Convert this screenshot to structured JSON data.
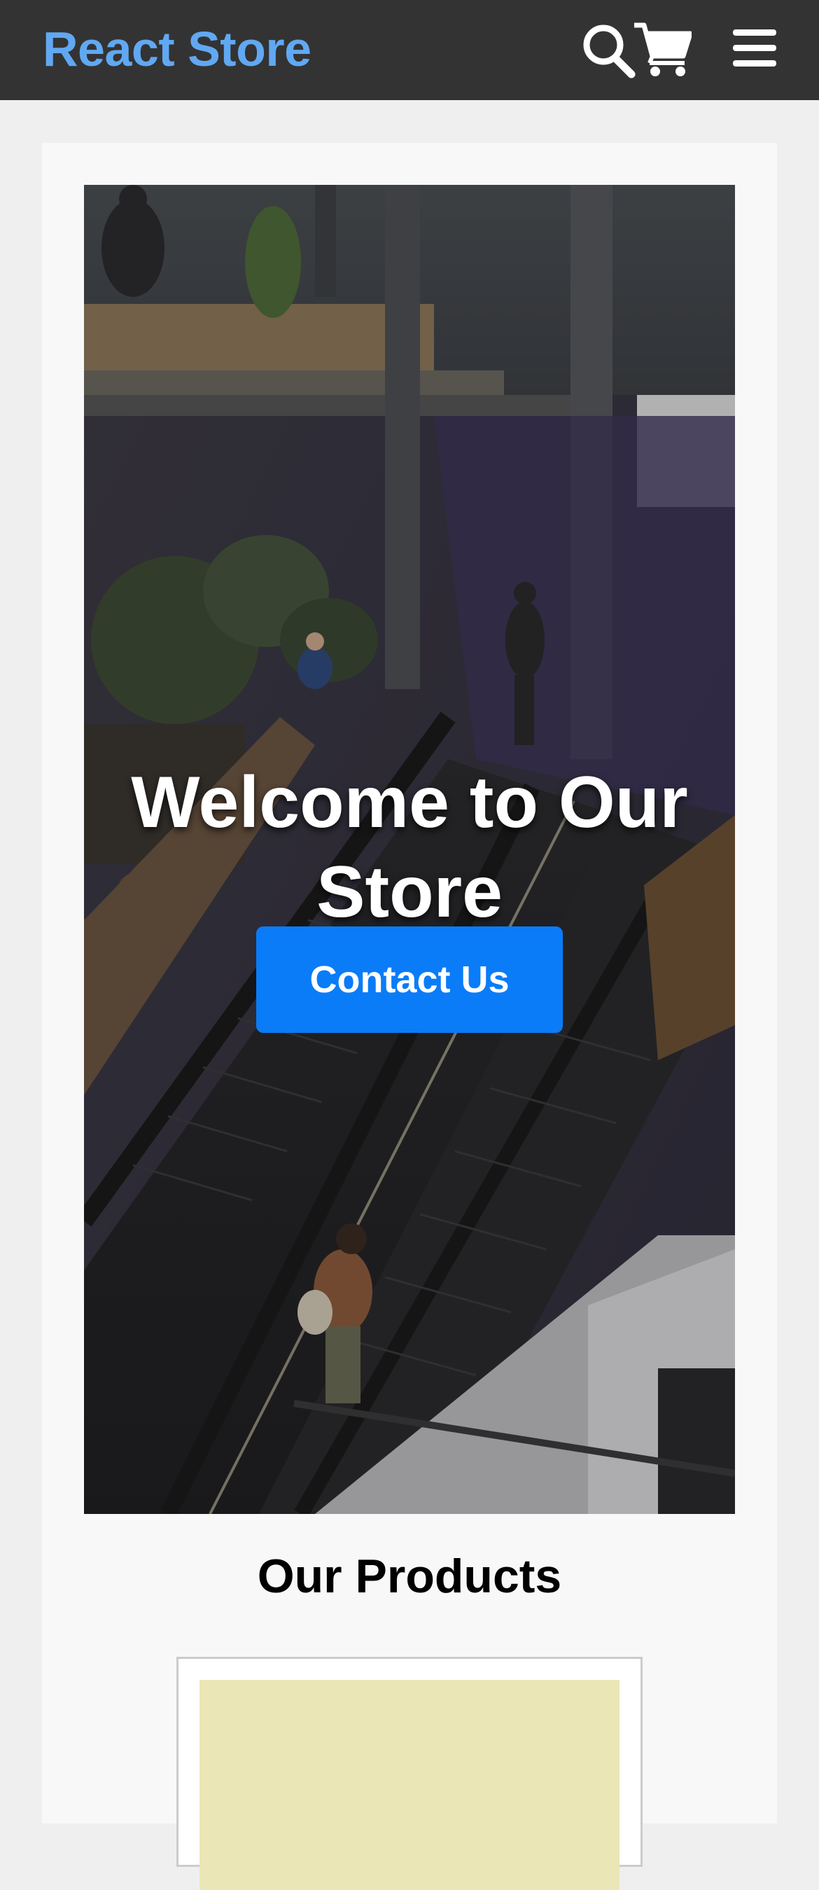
{
  "navbar": {
    "brand": "React Store",
    "icons": [
      "search-icon",
      "cart-icon",
      "menu-icon"
    ],
    "background_color": "#333333",
    "brand_color": "#61a8f2"
  },
  "hero": {
    "title": "Welcome to Our Store",
    "button_label": "Contact Us",
    "button_color": "#0a7cf8"
  },
  "products": {
    "heading": "Our Products",
    "placeholder_color": "#ebe6b6"
  }
}
